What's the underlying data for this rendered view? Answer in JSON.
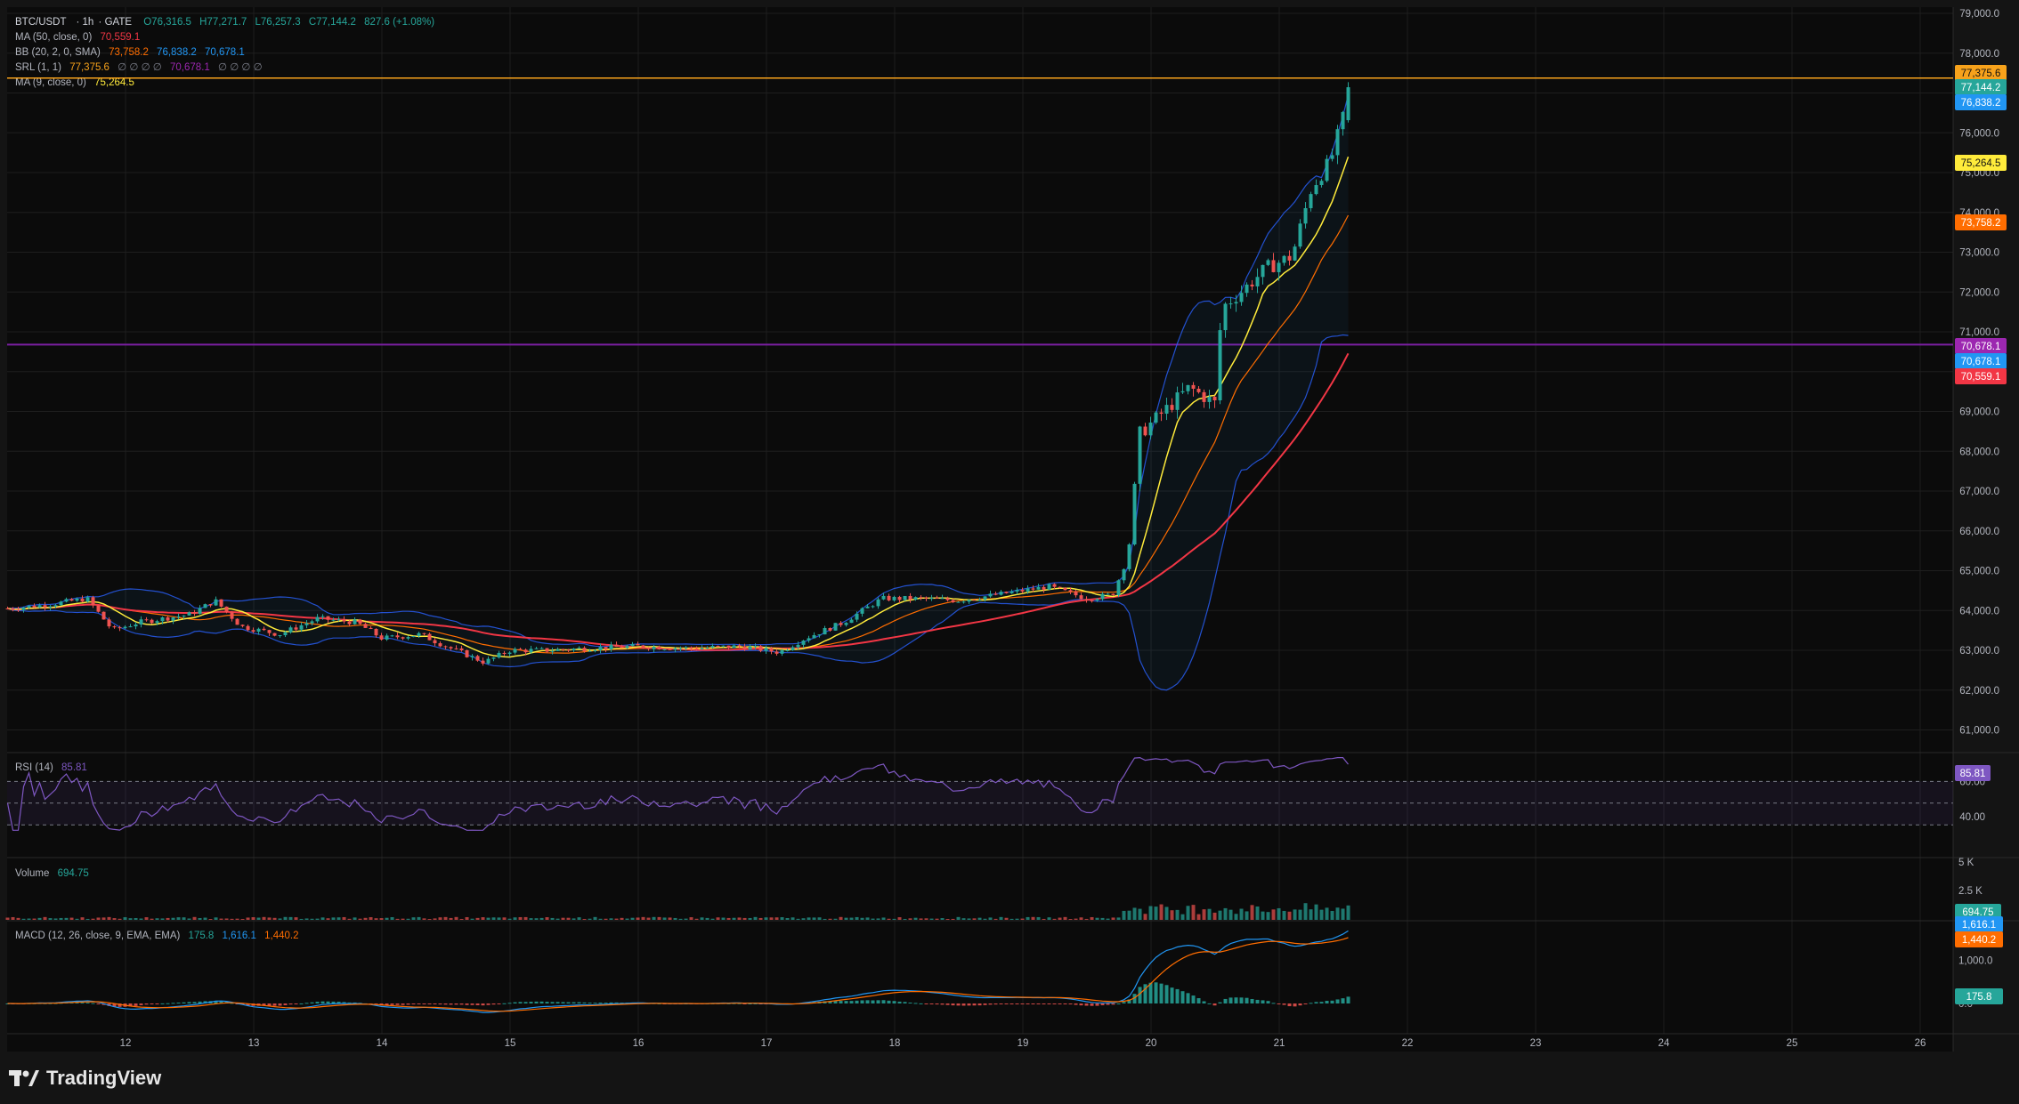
{
  "header": {
    "symbol": "BTC/USDT",
    "interval": "1h",
    "exchange": "GATE",
    "open": "O76,316.5",
    "high": "H77,271.7",
    "low": "L76,257.3",
    "close": "C77,144.2",
    "change": "827.6 (+1.08%)"
  },
  "indicators": {
    "ma50": {
      "label": "MA (50, close, 0)",
      "value": "70,559.1"
    },
    "bb": {
      "label": "BB (20, 2, 0, SMA)",
      "basis": "73,758.2",
      "upper": "76,838.2",
      "lower": "70,678.1"
    },
    "srl": {
      "label": "SRL (1, 1)",
      "v1": "77,375.6",
      "empties1": "∅ ∅ ∅ ∅",
      "v2": "70,678.1",
      "empties2": "∅ ∅ ∅ ∅"
    },
    "ma9": {
      "label": "MA (9, close, 0)",
      "value": "75,264.5"
    },
    "rsi": {
      "label": "RSI (14)",
      "value": "85.81"
    },
    "volume": {
      "label": "Volume",
      "value": "694.75"
    },
    "macd": {
      "label": "MACD (12, 26, close, 9, EMA, EMA)",
      "hist": "175.8",
      "macd": "1,616.1",
      "signal": "1,440.2"
    }
  },
  "price_axis": {
    "ticks": [
      "79,000.0",
      "78,000.0",
      "77,000.0",
      "76,000.0",
      "75,000.0",
      "74,000.0",
      "73,000.0",
      "72,000.0",
      "71,000.0",
      "70,000.0",
      "69,000.0",
      "68,000.0",
      "67,000.0",
      "66,000.0",
      "65,000.0",
      "64,000.0",
      "63,000.0",
      "62,000.0",
      "61,000.0"
    ],
    "badges": [
      {
        "text": "77,375.6",
        "color": "#f7a21b",
        "tcolor": "#111111"
      },
      {
        "text": "77,144.2",
        "color": "#26a69a",
        "tcolor": "#ffffff"
      },
      {
        "text": "76,838.2",
        "color": "#2196f3",
        "tcolor": "#ffffff"
      },
      {
        "text": "75,264.5",
        "color": "#ffeb3b",
        "tcolor": "#111111"
      },
      {
        "text": "73,758.2",
        "color": "#ff6d00",
        "tcolor": "#ffffff"
      },
      {
        "text": "70,678.1",
        "color": "#9c27b0",
        "tcolor": "#ffffff"
      },
      {
        "text": "70,678.1",
        "color": "#2196f3",
        "tcolor": "#ffffff"
      },
      {
        "text": "70,559.1",
        "color": "#f23645",
        "tcolor": "#ffffff"
      }
    ]
  },
  "rsi_axis": {
    "ticks": [
      "60.00",
      "40.00"
    ],
    "badge": "85.81"
  },
  "volume_axis": {
    "ticks": [
      "5 K",
      "2.5 K"
    ],
    "badge": "694.75"
  },
  "macd_axis": {
    "ticks": [
      "1,000.0",
      "0.0"
    ],
    "badges": [
      "1,616.1",
      "1,440.2",
      "175.8"
    ]
  },
  "time_axis": {
    "ticks": [
      "12",
      "13",
      "14",
      "15",
      "16",
      "17",
      "18",
      "19",
      "20",
      "21",
      "22",
      "23",
      "24",
      "25",
      "26"
    ]
  },
  "colors": {
    "bg": "#0b0b0b",
    "grid": "#1e1e1e",
    "up": "#26a69a",
    "down": "#ef5350",
    "ma9": "#ffeb3b",
    "bb_basis": "#ff6d00",
    "bb_band": "#2962ff",
    "ma50": "#f23645",
    "srl_res": "#f7a21b",
    "srl_sup": "#7b1fa2",
    "rsi": "#7e57c2",
    "text": "#d1d4dc"
  },
  "brand": {
    "name": "TradingView"
  },
  "chart_data": {
    "type": "candlestick",
    "title": "BTC/USDT · 1h · GATE",
    "x_ticks": [
      "12",
      "13",
      "14",
      "15",
      "16",
      "17",
      "18",
      "19",
      "20",
      "21",
      "22",
      "23",
      "24",
      "25",
      "26"
    ],
    "ylim": [
      60500,
      79200
    ],
    "close_path": [
      {
        "day": 11.1,
        "close": 64050
      },
      {
        "day": 11.4,
        "close": 64150
      },
      {
        "day": 11.7,
        "close": 64300
      },
      {
        "day": 11.9,
        "close": 63500
      },
      {
        "day": 12.1,
        "close": 63700
      },
      {
        "day": 12.5,
        "close": 63900
      },
      {
        "day": 12.7,
        "close": 64250
      },
      {
        "day": 12.9,
        "close": 63600
      },
      {
        "day": 13.2,
        "close": 63400
      },
      {
        "day": 13.5,
        "close": 63800
      },
      {
        "day": 13.8,
        "close": 63700
      },
      {
        "day": 14.0,
        "close": 63300
      },
      {
        "day": 14.3,
        "close": 63400
      },
      {
        "day": 14.5,
        "close": 63100
      },
      {
        "day": 14.8,
        "close": 62700
      },
      {
        "day": 15.0,
        "close": 63000
      },
      {
        "day": 15.3,
        "close": 63000
      },
      {
        "day": 15.6,
        "close": 63050
      },
      {
        "day": 16.0,
        "close": 63100
      },
      {
        "day": 16.4,
        "close": 63050
      },
      {
        "day": 16.8,
        "close": 63100
      },
      {
        "day": 17.1,
        "close": 62950
      },
      {
        "day": 17.3,
        "close": 63300
      },
      {
        "day": 17.6,
        "close": 63700
      },
      {
        "day": 17.9,
        "close": 64300
      },
      {
        "day": 18.2,
        "close": 64300
      },
      {
        "day": 18.5,
        "close": 64250
      },
      {
        "day": 18.8,
        "close": 64400
      },
      {
        "day": 19.2,
        "close": 64600
      },
      {
        "day": 19.5,
        "close": 64300
      },
      {
        "day": 19.7,
        "close": 64400
      },
      {
        "day": 19.8,
        "close": 65200
      },
      {
        "day": 19.85,
        "close": 66000
      },
      {
        "day": 19.9,
        "close": 68400
      },
      {
        "day": 20.1,
        "close": 69000
      },
      {
        "day": 20.3,
        "close": 69600
      },
      {
        "day": 20.5,
        "close": 69200
      },
      {
        "day": 20.55,
        "close": 71600
      },
      {
        "day": 20.7,
        "close": 72000
      },
      {
        "day": 20.9,
        "close": 72600
      },
      {
        "day": 21.1,
        "close": 72900
      },
      {
        "day": 21.25,
        "close": 74600
      },
      {
        "day": 21.4,
        "close": 75300
      },
      {
        "day": 21.5,
        "close": 76400
      },
      {
        "day": 21.55,
        "close": 77144.2
      }
    ],
    "last_values": {
      "open": 76316.5,
      "high": 77271.7,
      "low": 76257.3,
      "close": 77144.2,
      "ma9": 75264.5,
      "bb_basis": 73758.2,
      "bb_upper": 76838.2,
      "bb_lower": 70678.1,
      "ma50": 70559.1,
      "srl_resistance": 77375.6,
      "srl_support": 70678.1,
      "rsi": 85.81,
      "volume": 694.75,
      "macd": 1616.1,
      "signal": 1440.2,
      "hist": 175.8
    }
  }
}
